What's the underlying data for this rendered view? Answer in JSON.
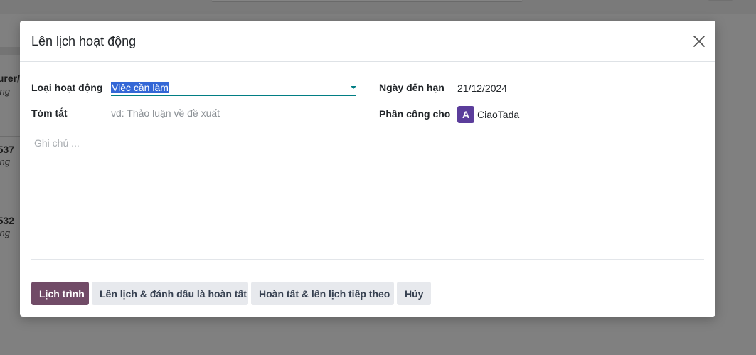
{
  "background": {
    "cards": [
      {
        "line1": "urer/",
        "line2": "ng"
      },
      {
        "line1": "537",
        "line2": "ng"
      },
      {
        "line1": "532",
        "line2": "ng"
      }
    ]
  },
  "dialog": {
    "title": "Lên lịch hoạt động",
    "close_icon": "close-icon",
    "fields": {
      "activity_type": {
        "label": "Loại hoạt động",
        "value": "Việc cần làm"
      },
      "summary": {
        "label": "Tóm tắt",
        "value": "",
        "placeholder": "vd: Thảo luận về đề xuất"
      },
      "due_date": {
        "label": "Ngày đến hạn",
        "value": "21/12/2024"
      },
      "assigned_to": {
        "label": "Phân công cho",
        "avatar_letter": "A",
        "user": "CiaoTada"
      },
      "notes": {
        "placeholder": "Ghi chú ..."
      }
    },
    "buttons": {
      "schedule": "Lịch trình",
      "schedule_mark_done": "Lên lịch & đánh dấu là hoàn tất",
      "done_schedule_next": "Hoàn tất & lên lịch tiếp theo",
      "cancel": "Hủy"
    }
  },
  "colors": {
    "primary": "#714b67",
    "accent": "#017e84",
    "avatar": "#5b3d9b",
    "selection": "#3367d6"
  }
}
